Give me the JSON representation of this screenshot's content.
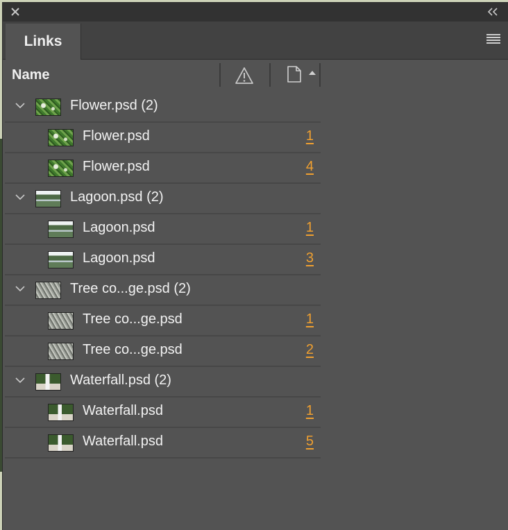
{
  "panel": {
    "tab_label": "Links",
    "column_name": "Name"
  },
  "icons": {
    "close": "close-icon",
    "collapse": "double-chevron-left-icon",
    "menu": "hamburger-menu-icon",
    "warning": "warning-icon",
    "page": "page-icon",
    "sort": "sort-up-icon",
    "expand": "chevron-down-icon"
  },
  "colors": {
    "panel_bg": "#535353",
    "page_link": "#f0a030"
  },
  "groups": [
    {
      "label": "Flower.psd (2)",
      "thumb": "flower",
      "children": [
        {
          "label": "Flower.psd",
          "page": "1"
        },
        {
          "label": "Flower.psd",
          "page": "4"
        }
      ]
    },
    {
      "label": "Lagoon.psd (2)",
      "thumb": "lagoon",
      "children": [
        {
          "label": "Lagoon.psd",
          "page": "1"
        },
        {
          "label": "Lagoon.psd",
          "page": "3"
        }
      ]
    },
    {
      "label": "Tree co...ge.psd (2)",
      "thumb": "tree",
      "children": [
        {
          "label": "Tree co...ge.psd",
          "page": "1"
        },
        {
          "label": "Tree co...ge.psd",
          "page": "2"
        }
      ]
    },
    {
      "label": "Waterfall.psd (2)",
      "thumb": "waterfall",
      "children": [
        {
          "label": "Waterfall.psd",
          "page": "1"
        },
        {
          "label": "Waterfall.psd",
          "page": "5"
        }
      ]
    }
  ]
}
